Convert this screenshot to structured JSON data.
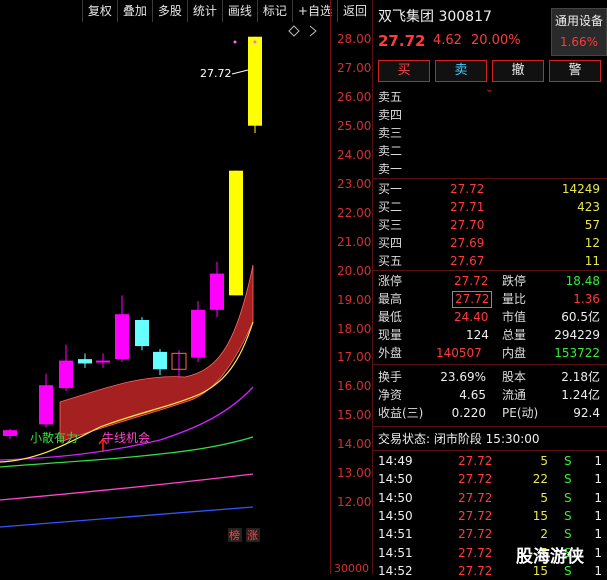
{
  "toolbar": {
    "buttons": [
      "复权",
      "叠加",
      "多股",
      "统计",
      "画线",
      "标记",
      "+自选",
      "返回"
    ]
  },
  "axis": {
    "price_labels": [
      "28.00",
      "27.00",
      "26.00",
      "25.00",
      "24.00",
      "23.00",
      "22.00",
      "21.00",
      "20.00",
      "19.00",
      "18.00",
      "17.00",
      "16.00",
      "15.00",
      "14.00",
      "13.00",
      "12.00"
    ],
    "volume_label": "30000"
  },
  "chart": {
    "peak_label": "27.72",
    "annot_1": "小散有力",
    "annot_2": "牛线机会",
    "badge_1": "榜",
    "badge_2": "涨",
    "colors": {
      "up": "#ff00ff",
      "down": "#66ffff",
      "limit": "#ffff00",
      "band": "#b22222"
    }
  },
  "chart_data": {
    "type": "candlestick",
    "ylim": [
      11.5,
      28.4
    ],
    "candles": [
      {
        "o": 13.95,
        "c": 14.15,
        "h": 14.2,
        "l": 13.85
      },
      {
        "o": 14.35,
        "c": 15.7,
        "h": 16.1,
        "l": 14.25
      },
      {
        "o": 15.6,
        "c": 16.55,
        "h": 17.1,
        "l": 15.5
      },
      {
        "o": 16.6,
        "c": 16.45,
        "h": 16.8,
        "l": 16.3
      },
      {
        "o": 16.55,
        "c": 16.55,
        "h": 16.8,
        "l": 16.3
      },
      {
        "o": 16.6,
        "c": 18.15,
        "h": 18.8,
        "l": 16.5
      },
      {
        "o": 17.95,
        "c": 17.05,
        "h": 18.05,
        "l": 16.9
      },
      {
        "o": 16.85,
        "c": 16.25,
        "h": 16.95,
        "l": 16.05
      },
      {
        "o": 16.25,
        "c": 16.8,
        "h": 16.9,
        "l": 15.95
      },
      {
        "o": 16.65,
        "c": 18.3,
        "h": 18.6,
        "l": 16.5
      },
      {
        "o": 18.3,
        "c": 19.55,
        "h": 19.95,
        "l": 18.05
      },
      {
        "o": 18.8,
        "c": 23.1,
        "h": 23.1,
        "l": 18.8
      },
      {
        "o": 24.65,
        "c": 27.72,
        "h": 27.72,
        "l": 24.4
      }
    ]
  },
  "stock": {
    "name": "双飞集团",
    "code": "300817",
    "price": "27.72",
    "change": "4.62",
    "pct": "20.00%",
    "general_label": "通用设备",
    "general_value": "1.66%"
  },
  "actions": [
    "买",
    "卖",
    "撤",
    "警"
  ],
  "sells": [
    "卖五",
    "卖四",
    "卖三",
    "卖二",
    "卖一"
  ],
  "buys": [
    {
      "label": "买一",
      "price": "27.72",
      "vol": "14249"
    },
    {
      "label": "买二",
      "price": "27.71",
      "vol": "423"
    },
    {
      "label": "买三",
      "price": "27.70",
      "vol": "57"
    },
    {
      "label": "买四",
      "price": "27.69",
      "vol": "12"
    },
    {
      "label": "买五",
      "price": "27.67",
      "vol": "11"
    }
  ],
  "stats1": [
    {
      "l1": "涨停",
      "v1": "27.72",
      "l2": "跌停",
      "v2": "18.48",
      "c2": "green"
    },
    {
      "l1": "最高",
      "v1": "27.72",
      "l2": "量比",
      "v2": "1.36",
      "c2": "red"
    },
    {
      "l1": "最低",
      "v1": "24.40",
      "l2": "市值",
      "v2": "60.5亿",
      "c2": "white"
    },
    {
      "l1": "现量",
      "v1": "124",
      "l2": "总量",
      "v2": "294229",
      "c2": "white"
    },
    {
      "l1": "外盘",
      "v1": "140507",
      "l2": "内盘",
      "v2": "153722",
      "c2": "green"
    }
  ],
  "stats2": [
    {
      "l1": "换手",
      "v1": "23.69%",
      "l2": "股本",
      "v2": "2.18亿"
    },
    {
      "l1": "净资",
      "v1": "4.65",
      "l2": "流通",
      "v2": "1.24亿"
    },
    {
      "l1": "收益(三)",
      "v1": "0.220",
      "l2": "PE(动)",
      "v2": "92.4"
    }
  ],
  "status_label": "交易状态: 闭市阶段 15:30:00",
  "ticks": [
    {
      "time": "14:49",
      "price": "27.72",
      "vol": "5",
      "side": "S",
      "num": "1"
    },
    {
      "time": "14:50",
      "price": "27.72",
      "vol": "22",
      "side": "S",
      "num": "1"
    },
    {
      "time": "14:50",
      "price": "27.72",
      "vol": "5",
      "side": "S",
      "num": "1"
    },
    {
      "time": "14:50",
      "price": "27.72",
      "vol": "15",
      "side": "S",
      "num": "1"
    },
    {
      "time": "14:51",
      "price": "27.72",
      "vol": "2",
      "side": "S",
      "num": "1"
    },
    {
      "time": "14:51",
      "price": "27.72",
      "vol": "5",
      "side": "S",
      "num": "1"
    },
    {
      "time": "14:52",
      "price": "27.72",
      "vol": "15",
      "side": "S",
      "num": "1"
    }
  ],
  "watermark": "股海游侠"
}
